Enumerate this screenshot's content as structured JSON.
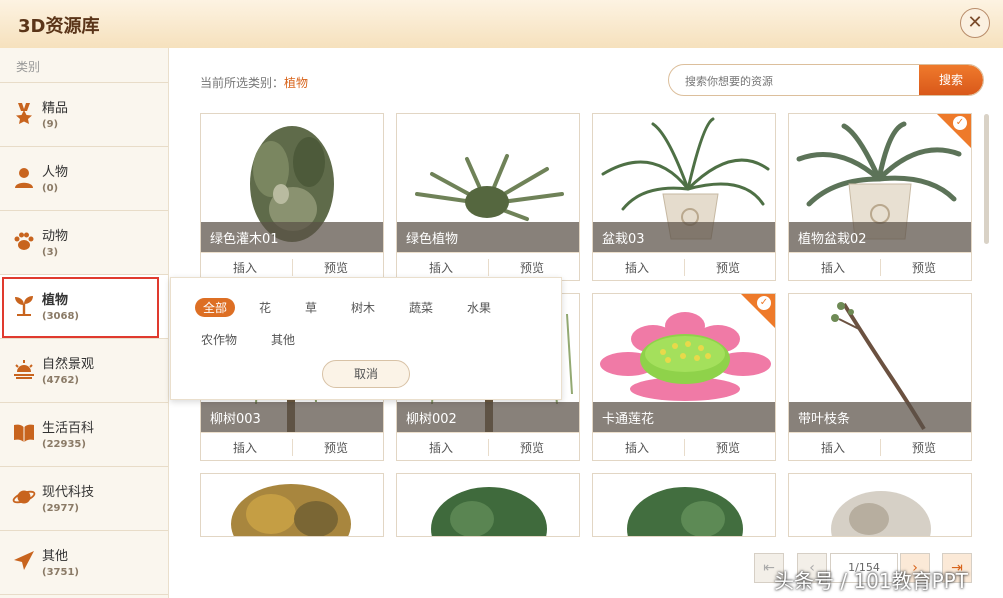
{
  "window": {
    "title": "3D资源库",
    "close_label": "✕"
  },
  "sidebar": {
    "header": "类别",
    "categories": [
      {
        "name": "精品",
        "count": "(9)",
        "icon": "medal-icon"
      },
      {
        "name": "人物",
        "count": "(0)",
        "icon": "person-icon"
      },
      {
        "name": "动物",
        "count": "(3)",
        "icon": "paw-icon"
      },
      {
        "name": "植物",
        "count": "(3068)",
        "icon": "sprout-icon"
      },
      {
        "name": "自然景观",
        "count": "(4762)",
        "icon": "sunset-icon"
      },
      {
        "name": "生活百科",
        "count": "(22935)",
        "icon": "book-icon"
      },
      {
        "name": "现代科技",
        "count": "(2977)",
        "icon": "planet-icon"
      },
      {
        "name": "其他",
        "count": "(3751)",
        "icon": "send-icon"
      }
    ],
    "selected_index": 3
  },
  "breadcrumb": {
    "prefix": "当前所选类别：",
    "current": "植物"
  },
  "search": {
    "placeholder": "搜索你想要的资源",
    "button": "搜索"
  },
  "grid": {
    "insert_label": "插入",
    "preview_label": "预览",
    "items": [
      {
        "label": "绿色灌木01",
        "thumb": "shrub",
        "selected": false
      },
      {
        "label": "绿色植物",
        "thumb": "fern",
        "selected": false
      },
      {
        "label": "盆栽03",
        "thumb": "potted-spider",
        "selected": false
      },
      {
        "label": "植物盆栽02",
        "thumb": "potted-cycad",
        "selected": true
      },
      {
        "label": "柳树003",
        "thumb": "willow",
        "selected": false
      },
      {
        "label": "柳树002",
        "thumb": "willow",
        "selected": false
      },
      {
        "label": "卡通莲花",
        "thumb": "lotus",
        "selected": true
      },
      {
        "label": "带叶枝条",
        "thumb": "branch",
        "selected": false
      },
      {
        "label": "",
        "thumb": "autumn-tree",
        "selected": false
      },
      {
        "label": "",
        "thumb": "green-tree",
        "selected": false
      },
      {
        "label": "",
        "thumb": "green-tree",
        "selected": false
      },
      {
        "label": "",
        "thumb": "white-tree",
        "selected": false
      }
    ]
  },
  "filter_popup": {
    "options": [
      "全部",
      "花",
      "草",
      "树木",
      "蔬菜",
      "水果",
      "农作物",
      "其他"
    ],
    "active_index": 0,
    "cancel": "取消"
  },
  "pager": {
    "page_text": "1/154",
    "first": "⇤",
    "prev": "‹",
    "next": "›",
    "last": "⇥"
  },
  "watermark": "头条号 / 101教育PPT",
  "colors": {
    "accent": "#dd6f24",
    "highlight_border": "#e03a2e"
  }
}
